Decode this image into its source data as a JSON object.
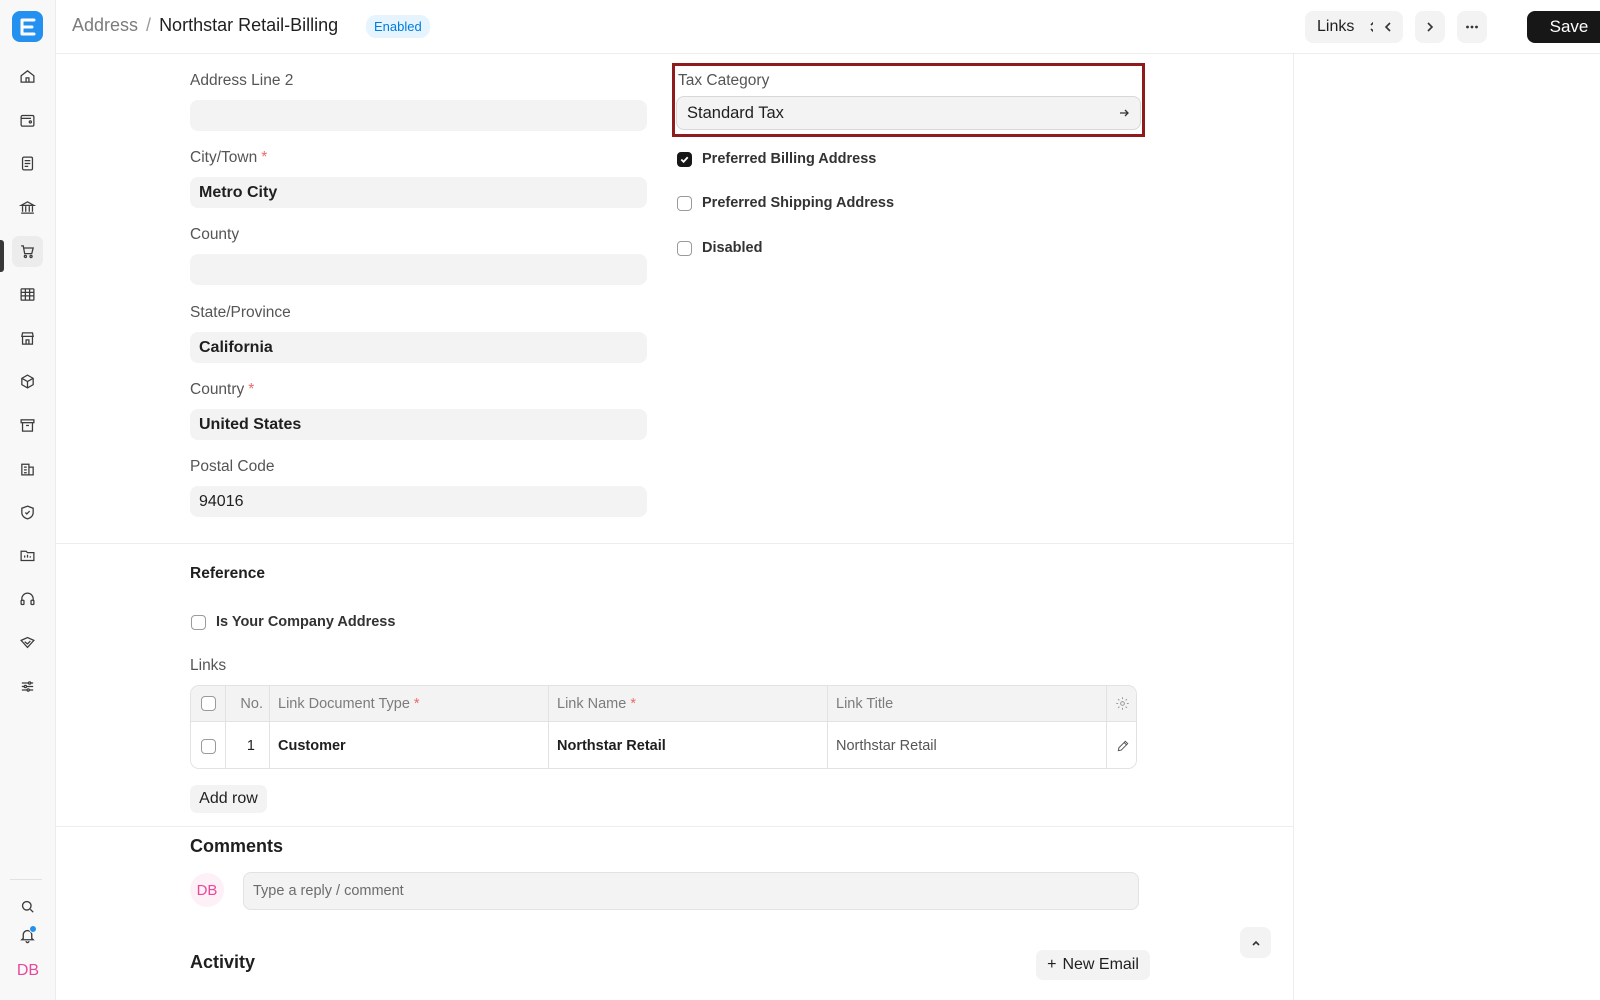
{
  "breadcrumb": {
    "parent": "Address",
    "separator": "/",
    "title": "Northstar Retail-Billing",
    "status": "Enabled"
  },
  "toolbar": {
    "links_label": "Links",
    "save_label": "Save"
  },
  "sidebar": {
    "items": [
      {
        "icon": "home-icon"
      },
      {
        "icon": "wallet-icon"
      },
      {
        "icon": "document-icon"
      },
      {
        "icon": "bank-icon"
      },
      {
        "icon": "cart-icon",
        "active": true
      },
      {
        "icon": "table-icon"
      },
      {
        "icon": "store-icon"
      },
      {
        "icon": "box-icon"
      },
      {
        "icon": "archive-icon"
      },
      {
        "icon": "building-icon"
      },
      {
        "icon": "shield-icon"
      },
      {
        "icon": "folder-icon"
      },
      {
        "icon": "headset-icon"
      },
      {
        "icon": "handshake-icon"
      },
      {
        "icon": "sliders-icon"
      }
    ],
    "user_initials": "DB"
  },
  "form": {
    "address_line2": {
      "label": "Address Line 2",
      "value": ""
    },
    "city": {
      "label": "City/Town",
      "required": "*",
      "value": "Metro City"
    },
    "county": {
      "label": "County",
      "value": ""
    },
    "state": {
      "label": "State/Province",
      "value": "California"
    },
    "country": {
      "label": "Country",
      "required": "*",
      "value": "United States"
    },
    "postal_code": {
      "label": "Postal Code",
      "value": "94016"
    },
    "tax_category": {
      "label": "Tax Category",
      "value": "Standard Tax"
    },
    "preferred_billing": {
      "label": "Preferred Billing Address",
      "checked": true
    },
    "preferred_shipping": {
      "label": "Preferred Shipping Address",
      "checked": false
    },
    "disabled": {
      "label": "Disabled",
      "checked": false
    }
  },
  "reference": {
    "section_title": "Reference",
    "is_company_address": {
      "label": "Is Your Company Address",
      "checked": false
    },
    "links_label": "Links",
    "table": {
      "headers": {
        "no": "No.",
        "doc_type": "Link Document Type",
        "doc_type_req": "*",
        "link_name": "Link Name",
        "link_name_req": "*",
        "link_title": "Link Title"
      },
      "rows": [
        {
          "no": "1",
          "doc_type": "Customer",
          "link_name": "Northstar Retail",
          "link_title": "Northstar Retail"
        }
      ]
    },
    "add_row_label": "Add row"
  },
  "comments": {
    "title": "Comments",
    "avatar_initials": "DB",
    "placeholder": "Type a reply / comment"
  },
  "activity": {
    "title": "Activity",
    "new_email_label": "New Email",
    "new_email_icon": "+"
  },
  "colors": {
    "accent": "#2490ef",
    "highlight_border": "#8f1c1c",
    "badge_bg": "#e6f4ff",
    "badge_text": "#007be0",
    "avatar_pink": "#e84a9a"
  }
}
